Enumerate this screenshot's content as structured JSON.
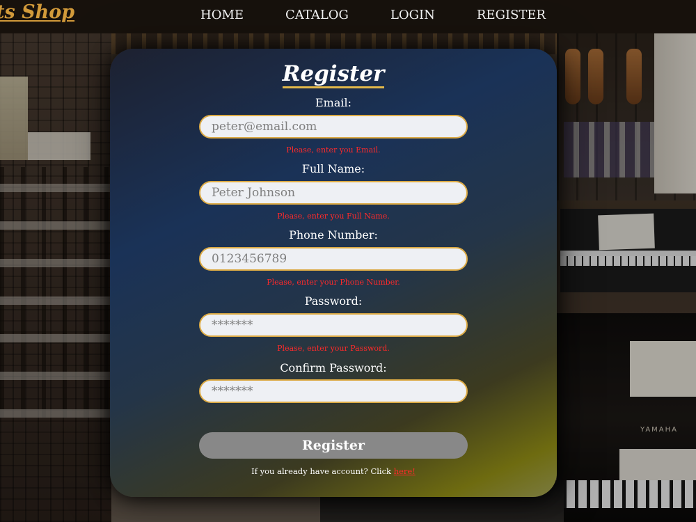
{
  "header": {
    "logo_text": "ts Shop",
    "nav": [
      {
        "label": "HOME"
      },
      {
        "label": "CATALOG"
      },
      {
        "label": "LOGIN"
      },
      {
        "label": "REGISTER"
      }
    ]
  },
  "background": {
    "piano_brand": "YAMAHA"
  },
  "form": {
    "title": "Register",
    "fields": [
      {
        "label": "Email:",
        "placeholder": "peter@email.com",
        "error": "Please, enter you Email."
      },
      {
        "label": "Full Name:",
        "placeholder": "Peter Johnson",
        "error": "Please, enter you Full Name."
      },
      {
        "label": "Phone Number:",
        "placeholder": "0123456789",
        "error": "Please, enter your Phone Number."
      },
      {
        "label": "Password:",
        "placeholder": "*******",
        "error": "Please, enter your Password."
      },
      {
        "label": "Confirm Password:",
        "placeholder": "*******",
        "error": ""
      }
    ],
    "submit_label": "Register",
    "footer_text": "If you already have account? Click ",
    "footer_link": "here!"
  },
  "colors": {
    "accent_gold": "#dcaa44",
    "error_red": "#ff2a2a",
    "button_gray": "#888888",
    "logo_gold": "#d29a3a"
  }
}
